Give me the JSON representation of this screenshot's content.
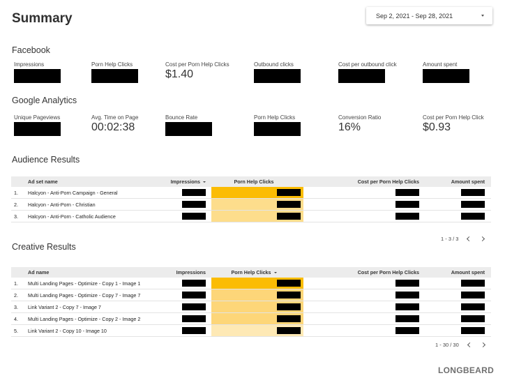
{
  "header": {
    "title": "Summary",
    "date_range": "Sep 2, 2021 - Sep 28, 2021"
  },
  "facebook": {
    "title": "Facebook",
    "metrics": [
      {
        "label": "Impressions",
        "value": null
      },
      {
        "label": "Porn Help Clicks",
        "value": null
      },
      {
        "label": "Cost per Porn Help Clicks",
        "value": "$1.40"
      },
      {
        "label": "Outbound clicks",
        "value": null
      },
      {
        "label": "Cost per outbound click",
        "value": null
      },
      {
        "label": "Amount spent",
        "value": null
      }
    ]
  },
  "google": {
    "title": "Google Analytics",
    "metrics": [
      {
        "label": "Unique Pageviews",
        "value": null
      },
      {
        "label": "Avg. Time on Page",
        "value": "00:02:38"
      },
      {
        "label": "Bounce Rate",
        "value": null
      },
      {
        "label": "Porn Help Clicks",
        "value": null
      },
      {
        "label": "Conversion Ratio",
        "value": "16%"
      },
      {
        "label": "Cost per Porn Help Click",
        "value": "$0.93"
      }
    ]
  },
  "audience": {
    "title": "Audience Results",
    "columns": [
      "Ad set name",
      "Impressions",
      "Porn Help Clicks",
      "Cost per Porn Help Clicks",
      "Amount spent"
    ],
    "rows": [
      {
        "index": "1.",
        "name": "Halcyon - Anti-Porn Campaign - General"
      },
      {
        "index": "2.",
        "name": "Halcyon - Anti-Porn - Christian"
      },
      {
        "index": "3.",
        "name": "Halcyon - Anti-Porn - Catholic Audience"
      }
    ],
    "pagination": "1 - 3 / 3",
    "heat_colors": [
      "#fbbc04",
      "#fddd8c",
      "#fddd8c"
    ]
  },
  "creative": {
    "title": "Creative Results",
    "columns": [
      "Ad name",
      "Impressions",
      "Porn Help Clicks",
      "Cost per Porn Help Clicks",
      "Amount spent"
    ],
    "rows": [
      {
        "index": "1.",
        "name": "Multi Landing Pages - Optimize - Copy 1 - Image 1"
      },
      {
        "index": "2.",
        "name": "Multi Landing Pages - Optimize - Copy 7 - Image 7"
      },
      {
        "index": "3.",
        "name": "Link Variant 2 - Copy 7 - Image 7"
      },
      {
        "index": "4.",
        "name": "Multi Landing Pages - Optimize - Copy 2 - Image 2"
      },
      {
        "index": "5.",
        "name": "Link Variant 2 - Copy 10 - Image 10"
      }
    ],
    "pagination": "1 - 30 / 30",
    "heat_colors": [
      "#fbbc04",
      "#fdd679",
      "#fdd679",
      "#fdd679",
      "#fee9b5"
    ]
  },
  "footer": {
    "logo": "LONGBEARD"
  }
}
